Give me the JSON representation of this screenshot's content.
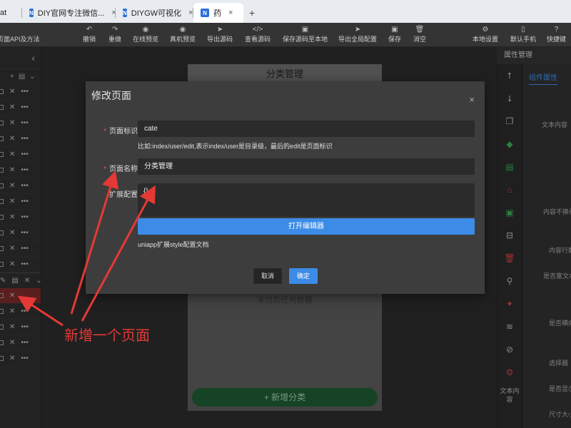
{
  "browser": {
    "tabs": [
      {
        "label": "at"
      },
      {
        "label": "DIY官网专注微信..."
      },
      {
        "label": "DIYGW可视化"
      },
      {
        "label": "药"
      }
    ],
    "new_tab": "+"
  },
  "toolbar": {
    "items": [
      {
        "label": "页面API及方法",
        "icon": "api-icon",
        "glyph": ""
      },
      {
        "label": "撤销",
        "icon": "undo-icon",
        "glyph": "↶"
      },
      {
        "label": "重做",
        "icon": "redo-icon",
        "glyph": "↷"
      },
      {
        "label": "在线预览",
        "icon": "eye-icon",
        "glyph": "◉"
      },
      {
        "label": "真机预览",
        "icon": "eye-icon",
        "glyph": "◉"
      },
      {
        "label": "导出源码",
        "icon": "send-icon",
        "glyph": "➤"
      },
      {
        "label": "查看源码",
        "icon": "code-icon",
        "glyph": "</>"
      },
      {
        "label": "保存源码至本地",
        "icon": "save-icon",
        "glyph": "▣"
      },
      {
        "label": "导出全局配置",
        "icon": "send-icon",
        "glyph": "➤"
      },
      {
        "label": "保存",
        "icon": "save-icon",
        "glyph": "▣"
      },
      {
        "label": "消空",
        "icon": "trash-icon",
        "glyph": "🗑"
      },
      {
        "label": "本地设置",
        "icon": "gear-icon",
        "glyph": "⚙"
      },
      {
        "label": "默认手机",
        "icon": "phone-icon",
        "glyph": "▯"
      },
      {
        "label": "快捷键",
        "icon": "help-icon",
        "glyph": "?"
      }
    ]
  },
  "left_panel": {
    "collapse_glyph": "‹",
    "add_glyph": "+",
    "row_count": 12
  },
  "phone": {
    "title": "分类管理",
    "empty_text": "未找到任何数据",
    "add_button": "+ 新增分类"
  },
  "attr_panel": {
    "header": "属性管理",
    "tab": "组件属性",
    "labels": [
      "文本内容",
      "内容不换行",
      "内容行数",
      "是否富文本",
      "是否横向",
      "选择器",
      "是否显示",
      "尺寸大小"
    ],
    "strip_text": "文本内容"
  },
  "modal": {
    "title": "修改页面",
    "close": "×",
    "fields": {
      "page_id": {
        "label": "页面标识",
        "value": "cate",
        "hint": "比如:index/user/edit,表示index/user是目录级，最后的edit是页面标识"
      },
      "page_name": {
        "label": "页面名称",
        "value": "分类管理"
      },
      "ext_config": {
        "label": "扩展配置",
        "value": "{}"
      }
    },
    "editor_button": "打开编辑器",
    "doc_link": "uniapp扩展style配置文档",
    "cancel": "取消",
    "confirm": "确定"
  },
  "annotation": {
    "text": "新增一个页面",
    "color": "#e53935"
  }
}
